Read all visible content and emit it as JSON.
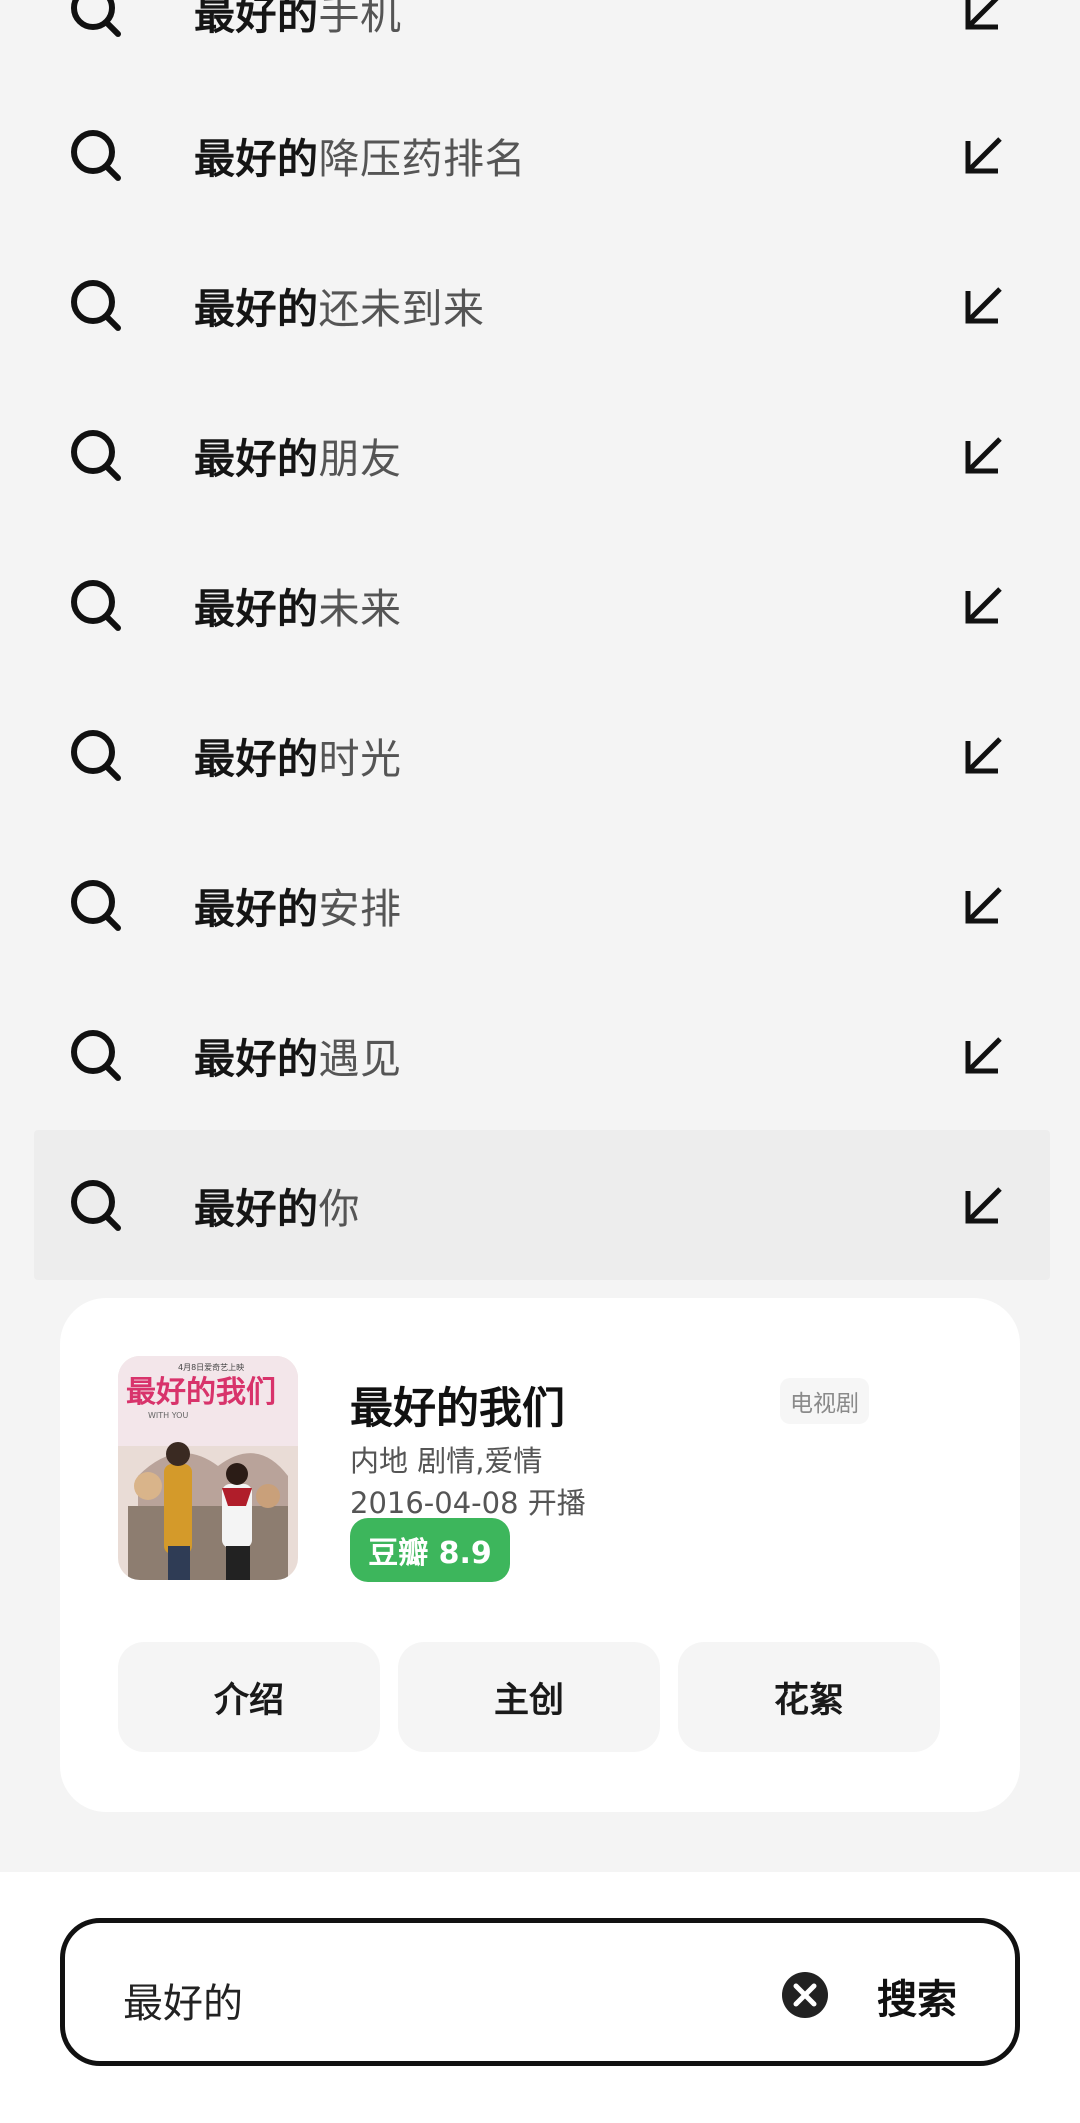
{
  "suggestions": [
    {
      "prefix": "最好的",
      "rest": "手机"
    },
    {
      "prefix": "最好的",
      "rest": "降压药排名"
    },
    {
      "prefix": "最好的",
      "rest": "还未到来"
    },
    {
      "prefix": "最好的",
      "rest": "朋友"
    },
    {
      "prefix": "最好的",
      "rest": "未来"
    },
    {
      "prefix": "最好的",
      "rest": "时光"
    },
    {
      "prefix": "最好的",
      "rest": "安排"
    },
    {
      "prefix": "最好的",
      "rest": "遇见"
    },
    {
      "prefix": "最好的",
      "rest": "你"
    }
  ],
  "card": {
    "title": "最好的我们",
    "type_badge": "电视剧",
    "meta_region_genre": "内地 剧情,爱情",
    "meta_air_date": "2016-04-08 开播",
    "rating_label": "豆瓣 8.9",
    "rating_color": "#3db65c",
    "buttons": [
      "介绍",
      "主创",
      "花絮"
    ],
    "poster": {
      "title_text": "最好的我们",
      "date_line": "4月8日爱奇艺上映",
      "sub_text": "WITH YOU"
    }
  },
  "search": {
    "query": "最好的",
    "submit_label": "搜索"
  },
  "icons": {
    "suggestion_left": "search-icon",
    "suggestion_right": "arrow-up-left-icon",
    "clear": "clear-icon"
  }
}
